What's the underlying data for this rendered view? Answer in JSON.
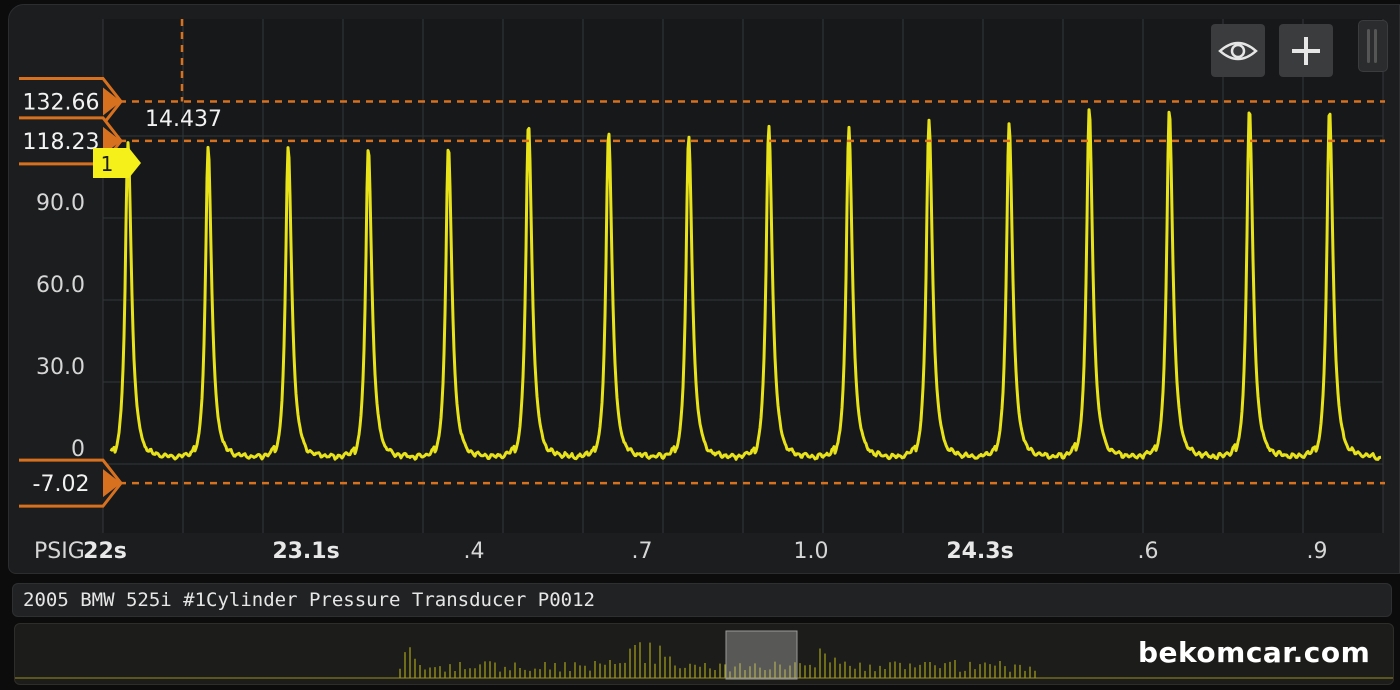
{
  "scope": {
    "unit_label": "PSIG",
    "y_ticks": [
      "90.0",
      "60.0",
      "30.0",
      "0"
    ],
    "time_ticks": [
      {
        "label": "22s",
        "bold": true
      },
      {
        "label": "23.1s",
        "bold": true
      },
      {
        "label": ".4",
        "bold": false
      },
      {
        "label": ".7",
        "bold": false
      },
      {
        "label": "1.0",
        "bold": false
      },
      {
        "label": "24.3s",
        "bold": true
      },
      {
        "label": ".6",
        "bold": false
      },
      {
        "label": ".9",
        "bold": false
      }
    ],
    "cursors": {
      "upper": "132.66",
      "middle": "118.23",
      "lower": "-7.02",
      "delta_readout": "14.437"
    },
    "channel_marker": "1",
    "colors": {
      "trace": "#e8e21a",
      "cursor": "#d7711f",
      "background": "#1b1d1f",
      "grid": "#34373a",
      "channel_marker": "#f5ef1a"
    }
  },
  "chart_data": {
    "type": "line",
    "ylabel": "PSIG",
    "ylim": [
      -7.02,
      132.66
    ],
    "series": [
      {
        "peak_values": [
          118,
          116,
          116,
          116,
          116,
          125,
          122,
          120,
          124,
          123,
          126,
          125,
          130,
          130,
          130,
          130
        ],
        "baseline_value": 0
      }
    ]
  },
  "toolbar": {
    "eye_icon": "eye-icon",
    "add_icon": "plus-icon"
  },
  "channel": {
    "title": "2005 BMW 525i #1Cylinder Pressure Transducer P0012"
  },
  "watermark": {
    "text": "bekomcar.com"
  }
}
